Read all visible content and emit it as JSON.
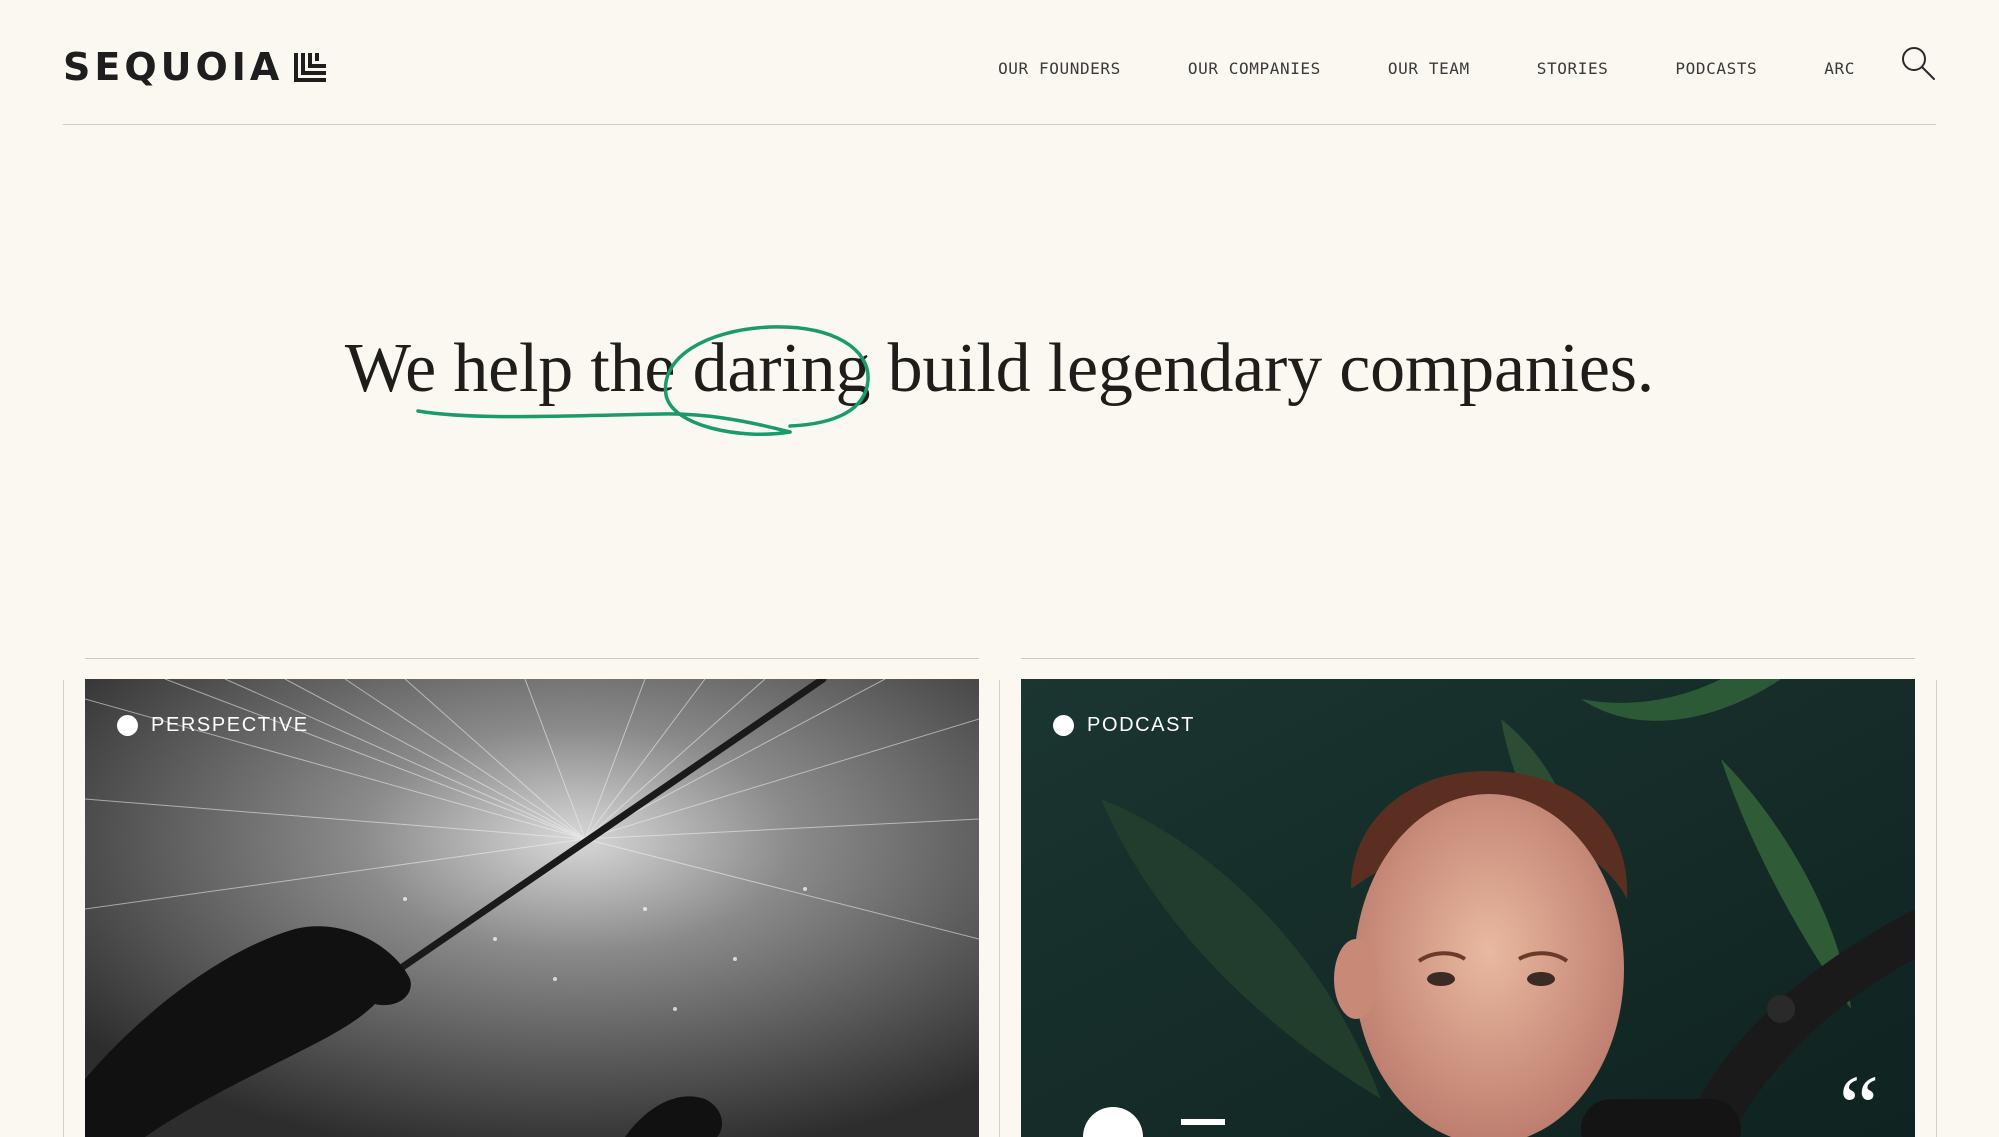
{
  "brand": {
    "name": "SEQUOIA"
  },
  "nav": {
    "items": [
      {
        "label": "OUR FOUNDERS"
      },
      {
        "label": "OUR COMPANIES"
      },
      {
        "label": "OUR TEAM"
      },
      {
        "label": "STORIES"
      },
      {
        "label": "PODCASTS"
      },
      {
        "label": "ARC"
      }
    ],
    "search_icon": "search-icon"
  },
  "hero": {
    "word_1": "We",
    "word_2": "help the",
    "word_3": "daring",
    "word_4": "build legendary companies.",
    "accent_color": "#1a9b6c"
  },
  "cards": [
    {
      "tag": "PERSPECTIVE",
      "image": "conductor-hand-with-baton-over-light-streaks"
    },
    {
      "tag": "PODCAST",
      "image": "man-speaking-into-microphone"
    }
  ],
  "colors": {
    "background": "#fbf8f2",
    "text": "#1f1d1a",
    "accent": "#1a9b6c"
  }
}
